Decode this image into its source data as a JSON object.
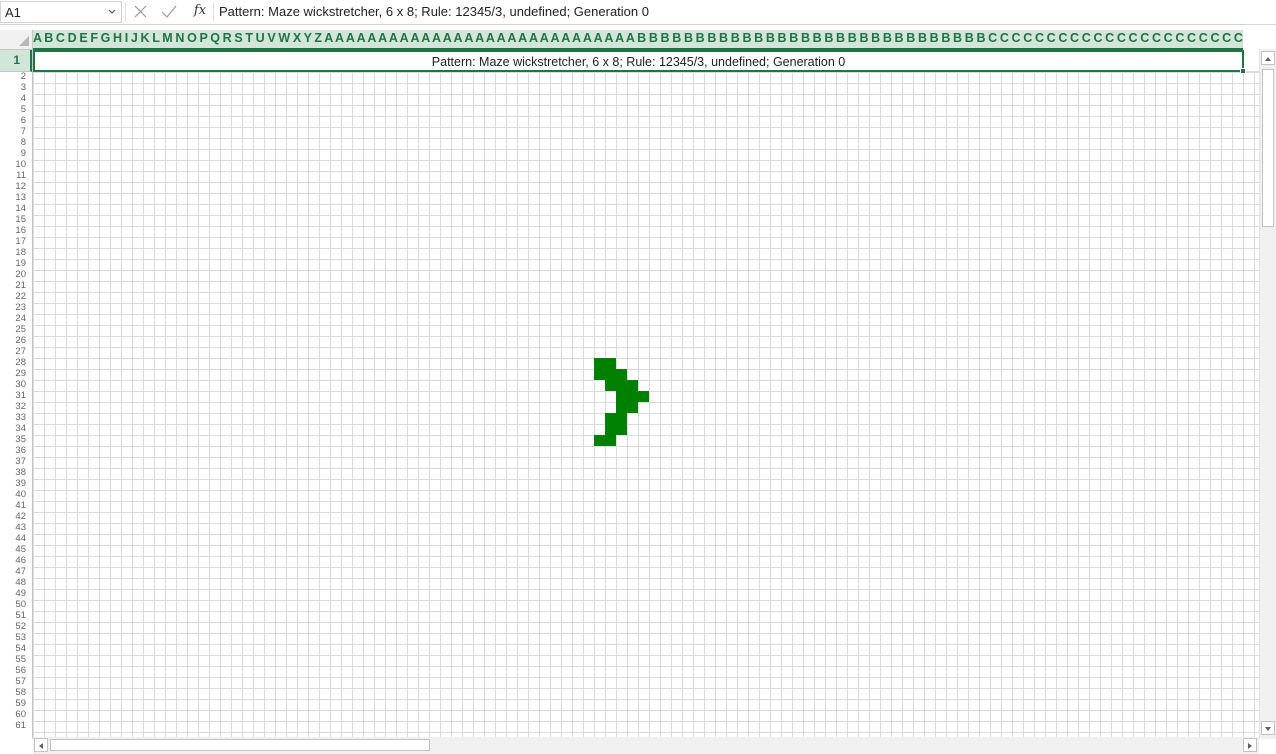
{
  "name_box": {
    "value": "A1"
  },
  "formula_bar": {
    "value": "Pattern: Maze wickstretcher, 6 x 8; Rule: 12345/3, undefined; Generation 0"
  },
  "column_headers": "A B C D E F G H I J K L M N O P Q R S T U V W X Y Z A A A A A A A A A A A A A A A A A A A A A A A A A A A A A B B B B B B B B B B B B B B B B B B B B B B B B B B B B B B C C C C C C C C C C C C C C C C C C C C C C C C C C C C C D D D D D D",
  "selected_row": "1",
  "cell_a1": "Pattern: Maze wickstretcher, 6 x 8; Rule: 12345/3, undefined; Generation 0",
  "row_numbers": [
    "2",
    "3",
    "4",
    "5",
    "6",
    "7",
    "8",
    "9",
    "10",
    "11",
    "12",
    "13",
    "14",
    "15",
    "16",
    "17",
    "18",
    "19",
    "20",
    "21",
    "22",
    "23",
    "24",
    "25",
    "26",
    "27",
    "28",
    "29",
    "30",
    "31",
    "32",
    "33",
    "34",
    "35",
    "36",
    "37",
    "38",
    "39",
    "40",
    "41",
    "42",
    "43",
    "44",
    "45",
    "46",
    "47",
    "48",
    "49",
    "50",
    "51",
    "52",
    "53",
    "54",
    "55",
    "56",
    "57",
    "58",
    "59",
    "60",
    "61"
  ],
  "pattern": {
    "live_color": "#008000",
    "cells": [
      {
        "row": 28,
        "col": 52
      },
      {
        "row": 28,
        "col": 53
      },
      {
        "row": 29,
        "col": 52
      },
      {
        "row": 29,
        "col": 53
      },
      {
        "row": 29,
        "col": 54
      },
      {
        "row": 30,
        "col": 53
      },
      {
        "row": 30,
        "col": 54
      },
      {
        "row": 30,
        "col": 55
      },
      {
        "row": 31,
        "col": 54
      },
      {
        "row": 31,
        "col": 55
      },
      {
        "row": 31,
        "col": 56
      },
      {
        "row": 32,
        "col": 54
      },
      {
        "row": 32,
        "col": 55
      },
      {
        "row": 33,
        "col": 53
      },
      {
        "row": 33,
        "col": 54
      },
      {
        "row": 34,
        "col": 53
      },
      {
        "row": 34,
        "col": 54
      },
      {
        "row": 35,
        "col": 52
      },
      {
        "row": 35,
        "col": 53
      }
    ]
  },
  "icons": {
    "name_box_dropdown": "chevron-down-icon",
    "cancel": "close-icon",
    "enter": "check-icon",
    "function": "fx-icon"
  }
}
